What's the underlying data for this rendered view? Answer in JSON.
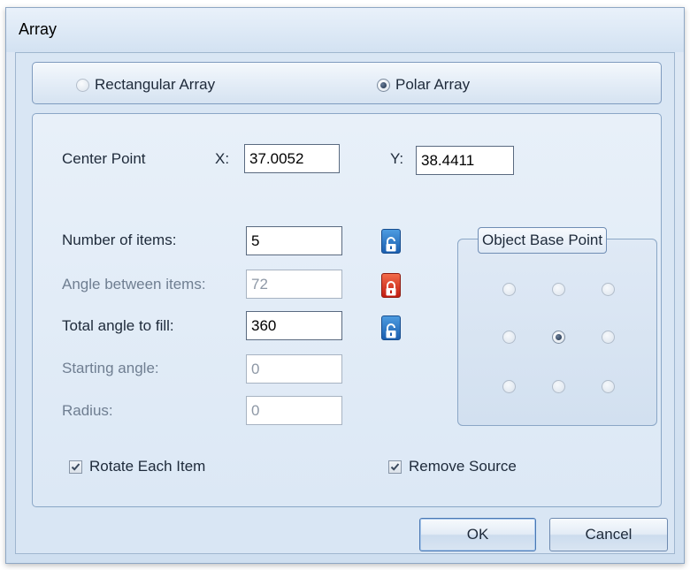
{
  "window": {
    "title": "Array"
  },
  "mode": {
    "rectangular_label": "Rectangular Array",
    "polar_label": "Polar Array",
    "selected": "Polar Array"
  },
  "center_point": {
    "label": "Center Point",
    "x_label": "X:",
    "x_value": "37.0052",
    "y_label": "Y:",
    "y_value": "38.4411"
  },
  "params": {
    "number_of_items": {
      "label": "Number of items:",
      "value": "5",
      "lock": "unlocked",
      "enabled": true
    },
    "angle_between_items": {
      "label": "Angle between items:",
      "value": "72",
      "lock": "locked",
      "enabled": false
    },
    "total_angle_to_fill": {
      "label": "Total angle to fill:",
      "value": "360",
      "lock": "unlocked",
      "enabled": true
    },
    "starting_angle": {
      "label": "Starting angle:",
      "value": "0",
      "enabled": false
    },
    "radius": {
      "label": "Radius:",
      "value": "0",
      "enabled": false
    }
  },
  "object_base_point": {
    "title": "Object Base Point",
    "selected": "middle-center"
  },
  "options": {
    "rotate_each_item": {
      "label": "Rotate Each Item",
      "checked": true
    },
    "remove_source": {
      "label": "Remove Source",
      "checked": true
    }
  },
  "buttons": {
    "ok": "OK",
    "cancel": "Cancel"
  },
  "colors": {
    "lock_unlocked": "#1b5fb0",
    "lock_locked": "#c21c12",
    "panel_bg": "#d9e6f4"
  }
}
